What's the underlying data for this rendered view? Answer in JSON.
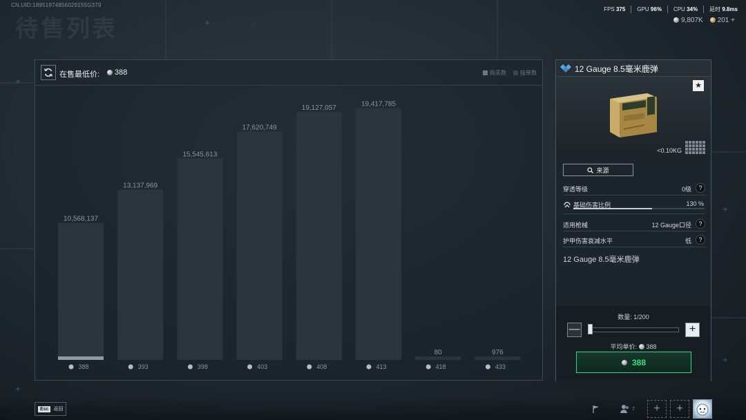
{
  "uid_text": "CN.UID:18951974856029155G379",
  "page_title": "待售列表",
  "top_stats": {
    "fps_label": "FPS",
    "fps_value": "375",
    "gpu_label": "GPU",
    "gpu_value": "96%",
    "cpu_label": "CPU",
    "cpu_value": "34%",
    "latency_label": "延时",
    "latency_value": "9.8ms"
  },
  "currency": {
    "silver": "9,807K",
    "gold": "201 +"
  },
  "chart_header": {
    "lowest_label": "在售最低价:",
    "lowest_value": "388",
    "legend_buy": "购买数",
    "legend_sell": "挂单数"
  },
  "chart_data": {
    "type": "bar",
    "categories": [
      "388",
      "393",
      "398",
      "403",
      "408",
      "413",
      "418",
      "433"
    ],
    "series": [
      {
        "name": "挂单数",
        "values": [
          10568137,
          13137969,
          15545613,
          17620749,
          19127057,
          19417785,
          80,
          976
        ]
      }
    ],
    "value_labels": [
      "10,568,137",
      "13,137,969",
      "15,545,613",
      "17,620,749",
      "19,127,057",
      "19,417,785",
      "80",
      "976"
    ],
    "ylim": [
      0,
      21000000
    ],
    "grid": false,
    "colors": {
      "bar": "#2b353c",
      "text": "#8a959c"
    }
  },
  "item": {
    "title": "12 Gauge 8.5毫米鹿弹",
    "weight": "<0.10KG",
    "source_btn": "来源",
    "attrs": [
      {
        "label": "穿透等级",
        "value": "0级"
      },
      {
        "label": "基础伤害比例",
        "value": "130 %"
      },
      {
        "label": "适用枪械",
        "value": "12 Gauge口径"
      },
      {
        "label": "护甲伤害衰减水平",
        "value": "低"
      }
    ],
    "damage_fraction": 0.6,
    "description": "12 Gauge 8.5毫米鹿弹",
    "qty_label": "数量: 1/200",
    "quantity": 1,
    "quantity_max": 200,
    "avg_label": "平均单价:",
    "avg_value": "388",
    "buy_price": "388",
    "q_mark": "?",
    "star": "★",
    "minus": "—",
    "plus": "+"
  },
  "bottom": {
    "esc_key": "Esc",
    "esc_label": "返回",
    "friend_count": "7",
    "slot_plus": "+"
  },
  "colors": {
    "accent_green": "#34e07c",
    "panel_border": "#3b4850"
  }
}
